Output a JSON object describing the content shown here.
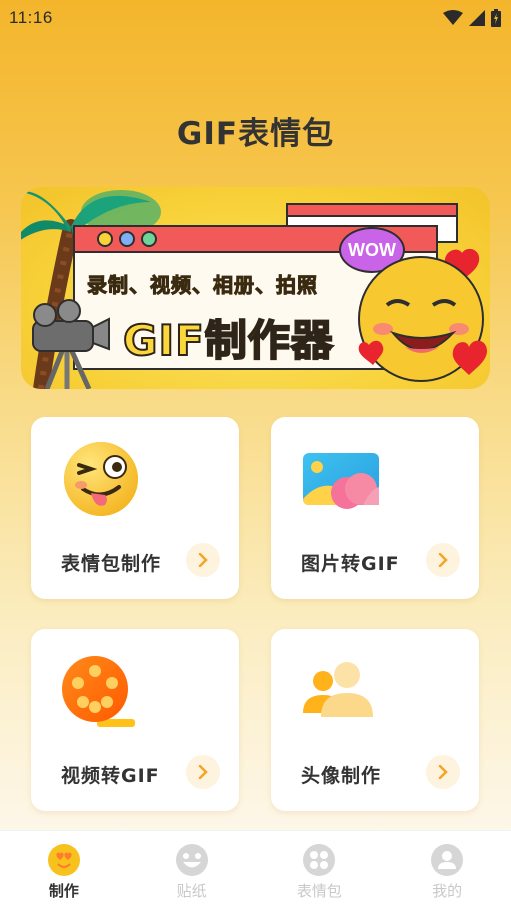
{
  "status_bar": {
    "time": "11:16"
  },
  "header": {
    "title": "GIF表情包"
  },
  "banner": {
    "subtitle": "录制、视频、相册、拍照",
    "title": "GIF制作器",
    "bubble": "WOW"
  },
  "cards": [
    {
      "label": "表情包制作",
      "icon": "winking-emoji-icon"
    },
    {
      "label": "图片转GIF",
      "icon": "image-icon"
    },
    {
      "label": "视频转GIF",
      "icon": "film-reel-icon"
    },
    {
      "label": "头像制作",
      "icon": "users-icon"
    }
  ],
  "tabs": [
    {
      "label": "制作",
      "icon": "smiley-icon",
      "active": true
    },
    {
      "label": "贴纸",
      "icon": "sticker-face-icon",
      "active": false
    },
    {
      "label": "表情包",
      "icon": "grid-icon",
      "active": false
    },
    {
      "label": "我的",
      "icon": "user-icon",
      "active": false
    }
  ],
  "colors": {
    "accent": "#f4b52c",
    "tab_active": "#333333",
    "tab_inactive": "#c9c9c9"
  }
}
